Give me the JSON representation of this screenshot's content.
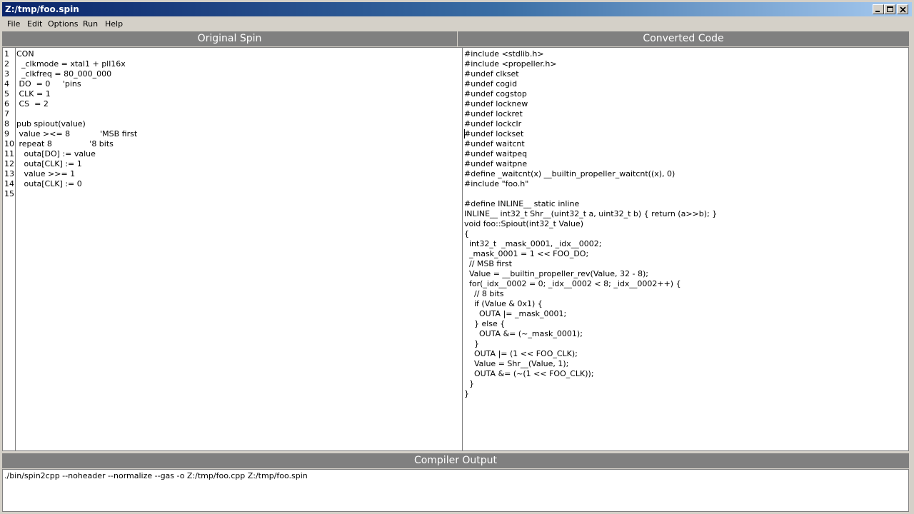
{
  "window": {
    "title": "Z:/tmp/foo.spin"
  },
  "menu": {
    "items": [
      "File",
      "Edit",
      "Options",
      "Run",
      "Help"
    ]
  },
  "panels": {
    "original_title": "Original Spin",
    "converted_title": "Converted Code",
    "output_title": "Compiler Output"
  },
  "spin": {
    "line_numbers": [
      "1",
      "2",
      "3",
      "4",
      "5",
      "6",
      "7",
      "8",
      "9",
      "10",
      "11",
      "12",
      "13",
      "14",
      "15"
    ],
    "lines": [
      "CON",
      "  _clkmode = xtal1 + pll16x",
      "  _clkfreq = 80_000_000",
      " DO  = 0     'pins",
      " CLK = 1",
      " CS  = 2",
      "",
      "pub spiout(value)",
      " value ><= 8            'MSB first",
      " repeat 8               '8 bits",
      "   outa[DO] := value",
      "   outa[CLK] := 1",
      "   value >>= 1",
      "   outa[CLK] := 0",
      ""
    ]
  },
  "converted": {
    "lines": [
      "#include <stdlib.h>",
      "#include <propeller.h>",
      "#undef clkset",
      "#undef cogid",
      "#undef cogstop",
      "#undef locknew",
      "#undef lockret",
      "#undef lockclr",
      "#undef lockset",
      "#undef waitcnt",
      "#undef waitpeq",
      "#undef waitpne",
      "#define _waitcnt(x) __builtin_propeller_waitcnt((x), 0)",
      "#include \"foo.h\"",
      "",
      "#define INLINE__ static inline",
      "INLINE__ int32_t Shr__(uint32_t a, uint32_t b) { return (a>>b); }",
      "void foo::Spiout(int32_t Value)",
      "{",
      "  int32_t  _mask_0001, _idx__0002;",
      "  _mask_0001 = 1 << FOO_DO;",
      "  // MSB first",
      "  Value = __builtin_propeller_rev(Value, 32 - 8);",
      "  for(_idx__0002 = 0; _idx__0002 < 8; _idx__0002++) {",
      "    // 8 bits",
      "    if (Value & 0x1) {",
      "      OUTA |= _mask_0001;",
      "    } else {",
      "      OUTA &= (~_mask_0001);",
      "    }",
      "    OUTA |= (1 << FOO_CLK);",
      "    Value = Shr__(Value, 1);",
      "    OUTA &= (~(1 << FOO_CLK));",
      "  }",
      "}"
    ]
  },
  "output": {
    "text": "./bin/spin2cpp --noheader --normalize --gas -o Z:/tmp/foo.cpp Z:/tmp/foo.spin"
  },
  "icons": [
    "minimize-icon",
    "maximize-icon",
    "close-icon"
  ]
}
